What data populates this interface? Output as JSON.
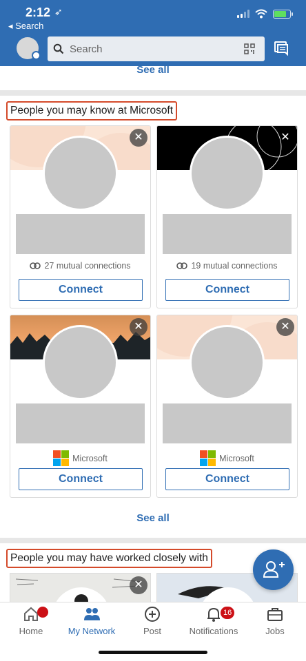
{
  "status_bar": {
    "time": "2:12",
    "back_label": "◂ Search"
  },
  "header": {
    "search_placeholder": "Search",
    "icons": [
      "search-icon",
      "qr-code-icon",
      "messaging-icon"
    ]
  },
  "top_see_all": "See all",
  "section_microsoft": {
    "title": "People you may know at Microsoft",
    "cards": [
      {
        "meta": "27 mutual connections",
        "connect": "Connect"
      },
      {
        "meta": "19 mutual connections",
        "connect": "Connect"
      },
      {
        "meta": "Microsoft",
        "connect": "Connect"
      },
      {
        "meta": "Microsoft",
        "connect": "Connect"
      }
    ],
    "see_all": "See all"
  },
  "section_worked": {
    "title": "People you may have worked closely with"
  },
  "tabs": [
    {
      "label": "Home",
      "icon": "home-icon"
    },
    {
      "label": "My Network",
      "icon": "my-network-icon",
      "active": true
    },
    {
      "label": "Post",
      "icon": "post-icon"
    },
    {
      "label": "Notifications",
      "icon": "bell-icon",
      "badge": "16"
    },
    {
      "label": "Jobs",
      "icon": "briefcase-icon"
    }
  ],
  "colors": {
    "brand_blue": "#2f6db3",
    "highlight_border": "#d44a2a",
    "badge_red": "#cc1016"
  }
}
